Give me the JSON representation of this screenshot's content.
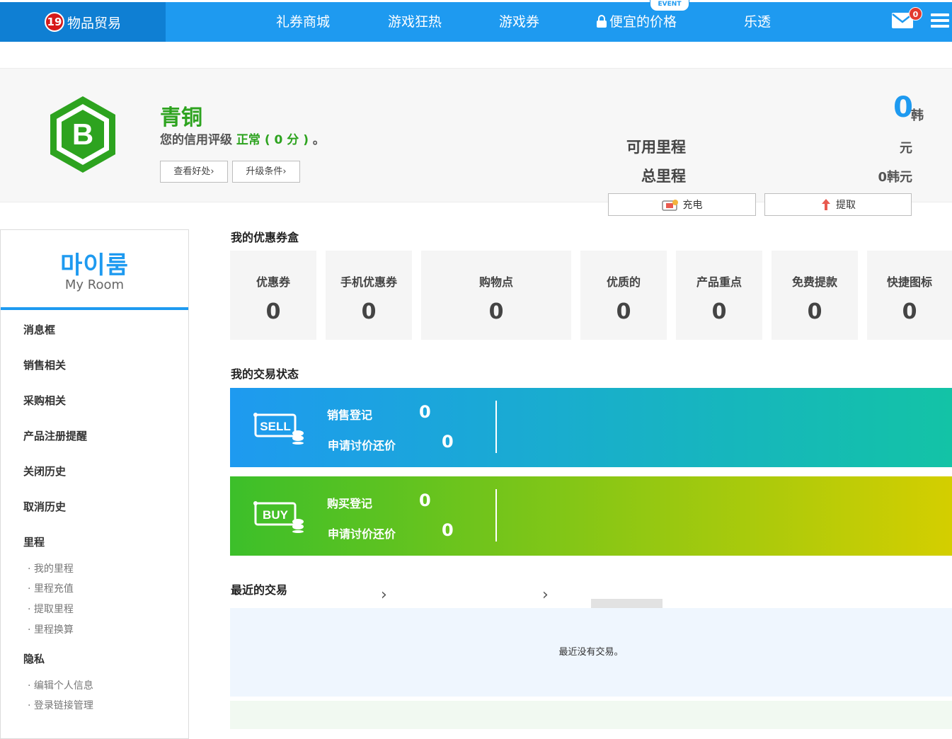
{
  "header": {
    "age_badge": "19",
    "brand": "物品贸易",
    "nav": [
      "礼券商城",
      "游戏狂热",
      "游戏券",
      "便宜的价格",
      "乐透"
    ],
    "event_badge": "EVENT",
    "mail_count": "0"
  },
  "profile": {
    "grade_letter": "B",
    "grade_name": "青铜",
    "credit_prefix": "您的信用评级",
    "credit_status": "正常 ( 0 分 )",
    "credit_suffix": "。",
    "btn_check": "查看好处",
    "btn_upgrade": "升级条件",
    "mileage_value": "0",
    "mileage_unit": "韩",
    "available_label": "可用里程",
    "available_value": "元",
    "total_label": "总里程",
    "total_value": "0韩元",
    "charge_btn": "充电",
    "withdraw_btn": "提取"
  },
  "sidebar": {
    "title_kr": "마이룸",
    "title_en": "My Room",
    "items": [
      "消息框",
      "销售相关",
      "采购相关",
      "产品注册提醒",
      "关闭历史",
      "取消历史"
    ],
    "mileage_header": "里程",
    "mileage_items": [
      "· 我的里程",
      "· 里程充值",
      "· 提取里程",
      "· 里程换算"
    ],
    "privacy_header": "隐私",
    "privacy_items": [
      "· 编辑个人信息",
      "· 登录链接管理"
    ]
  },
  "coupon_box": {
    "title": "我的优惠券盒",
    "items": [
      {
        "label": "优惠券",
        "value": "0"
      },
      {
        "label": "手机优惠券",
        "value": "0"
      },
      {
        "label": "购物点",
        "value": "0"
      },
      {
        "label": "优质的",
        "value": "0"
      },
      {
        "label": "产品重点",
        "value": "0"
      },
      {
        "label": "免费提款",
        "value": "0"
      },
      {
        "label": "快捷图标",
        "value": "0"
      }
    ]
  },
  "trade_status": {
    "title": "我的交易状态",
    "sell": {
      "icon_text": "SELL",
      "reg_label": "销售登记",
      "reg_value": "0",
      "nego_label": "申请讨价还价",
      "nego_value": "0"
    },
    "buy": {
      "icon_text": "BUY",
      "reg_label": "购买登记",
      "reg_value": "0",
      "nego_label": "申请讨价还价",
      "nego_value": "0"
    }
  },
  "recent": {
    "title": "最近的交易",
    "empty_message": "最近没有交易。"
  },
  "colors": {
    "accent": "#1e9af0",
    "grade_green": "#2da31f",
    "alert_red": "#e23b2f"
  }
}
